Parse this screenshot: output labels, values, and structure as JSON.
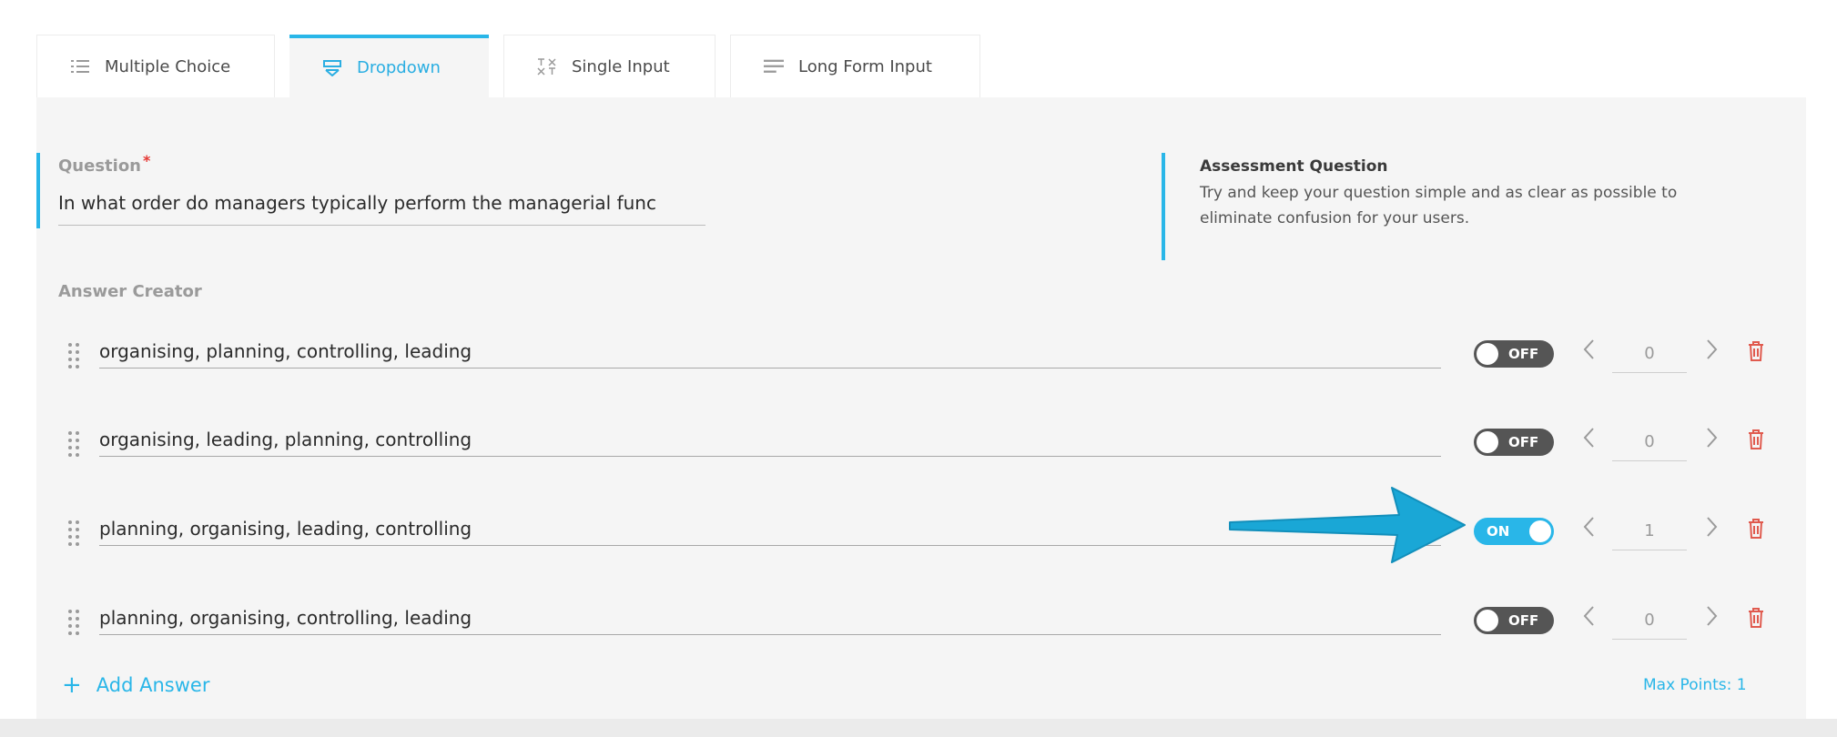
{
  "tabs": [
    {
      "label": "Multiple Choice",
      "icon": "list-icon"
    },
    {
      "label": "Dropdown",
      "icon": "dropdown-icon",
      "active": true
    },
    {
      "label": "Single Input",
      "icon": "text-icon"
    },
    {
      "label": "Long Form Input",
      "icon": "paragraph-icon"
    }
  ],
  "question": {
    "label": "Question",
    "required_mark": "*",
    "value": "In what order do managers typically perform the managerial func"
  },
  "assessment": {
    "title": "Assessment Question",
    "text": "Try and keep your question simple and as clear as possible to eliminate confusion for your users."
  },
  "answer_creator": {
    "label": "Answer Creator",
    "answers": [
      {
        "text": " organising, planning, controlling, leading",
        "correct": false,
        "toggle_label": "OFF",
        "points": "0"
      },
      {
        "text": "organising, leading, planning, controlling",
        "correct": false,
        "toggle_label": "OFF",
        "points": "0"
      },
      {
        "text": "planning, organising, leading, controlling",
        "correct": true,
        "toggle_label": "ON",
        "points": "1"
      },
      {
        "text": "planning, organising, controlling, leading",
        "correct": false,
        "toggle_label": "OFF",
        "points": "0"
      }
    ],
    "add_answer_label": "Add Answer",
    "max_points_label": "Max Points: 1"
  },
  "colors": {
    "accent": "#29b6e8",
    "toggle_off": "#555555",
    "delete": "#e05a4e",
    "panel_bg": "#f5f5f5"
  }
}
